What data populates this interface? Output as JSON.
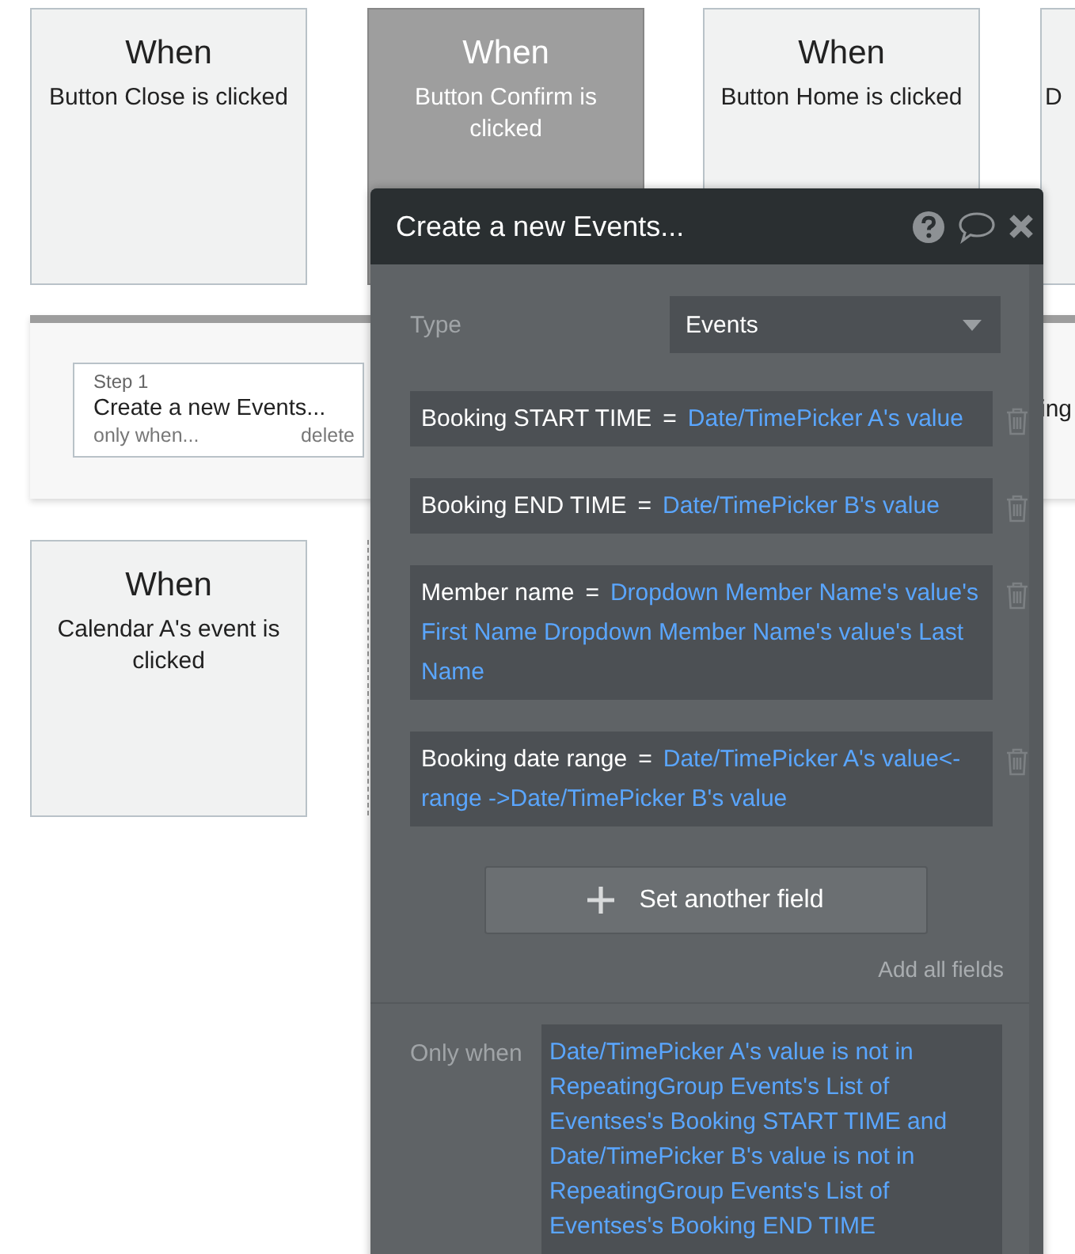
{
  "event_cards": [
    {
      "heading": "When",
      "label": "Button Close is clicked",
      "selected": false
    },
    {
      "heading": "When",
      "label": "Button Confirm is clicked",
      "selected": true
    },
    {
      "heading": "When",
      "label": "Button Home is clicked",
      "selected": false
    },
    {
      "label": "D",
      "selected": false
    },
    {
      "heading": "When",
      "label": "Calendar A's event is clicked",
      "selected": false
    }
  ],
  "step_panel": {
    "steps": [
      {
        "step": "Step 1",
        "title": "Create a new Events...",
        "condition": "only when...",
        "delete": "delete"
      },
      {
        "title": "ing"
      }
    ]
  },
  "action_popup": {
    "title": "Create a new Events...",
    "type_label": "Type",
    "type_value": "Events",
    "fields": [
      {
        "name": "Booking START TIME",
        "operator": "=",
        "value": "Date/TimePicker A's value"
      },
      {
        "name": "Booking END TIME",
        "operator": "=",
        "value": "Date/TimePicker B's value"
      },
      {
        "name": "Member name",
        "operator": "=",
        "value": "Dropdown Member Name's value's First Name Dropdown Member Name's value's Last Name"
      },
      {
        "name": "Booking date range",
        "operator": "=",
        "value": "Date/TimePicker A's value<-range ->Date/TimePicker B's value"
      }
    ],
    "add_field_button": "Set another field",
    "add_all_link": "Add all fields",
    "condition_label": "Only when",
    "condition": "Date/TimePicker A's value is not in RepeatingGroup Events's List of Eventses's Booking START TIME and Date/TimePicker B's value is not in RepeatingGroup Events's List of Eventses's Booking END TIME"
  }
}
